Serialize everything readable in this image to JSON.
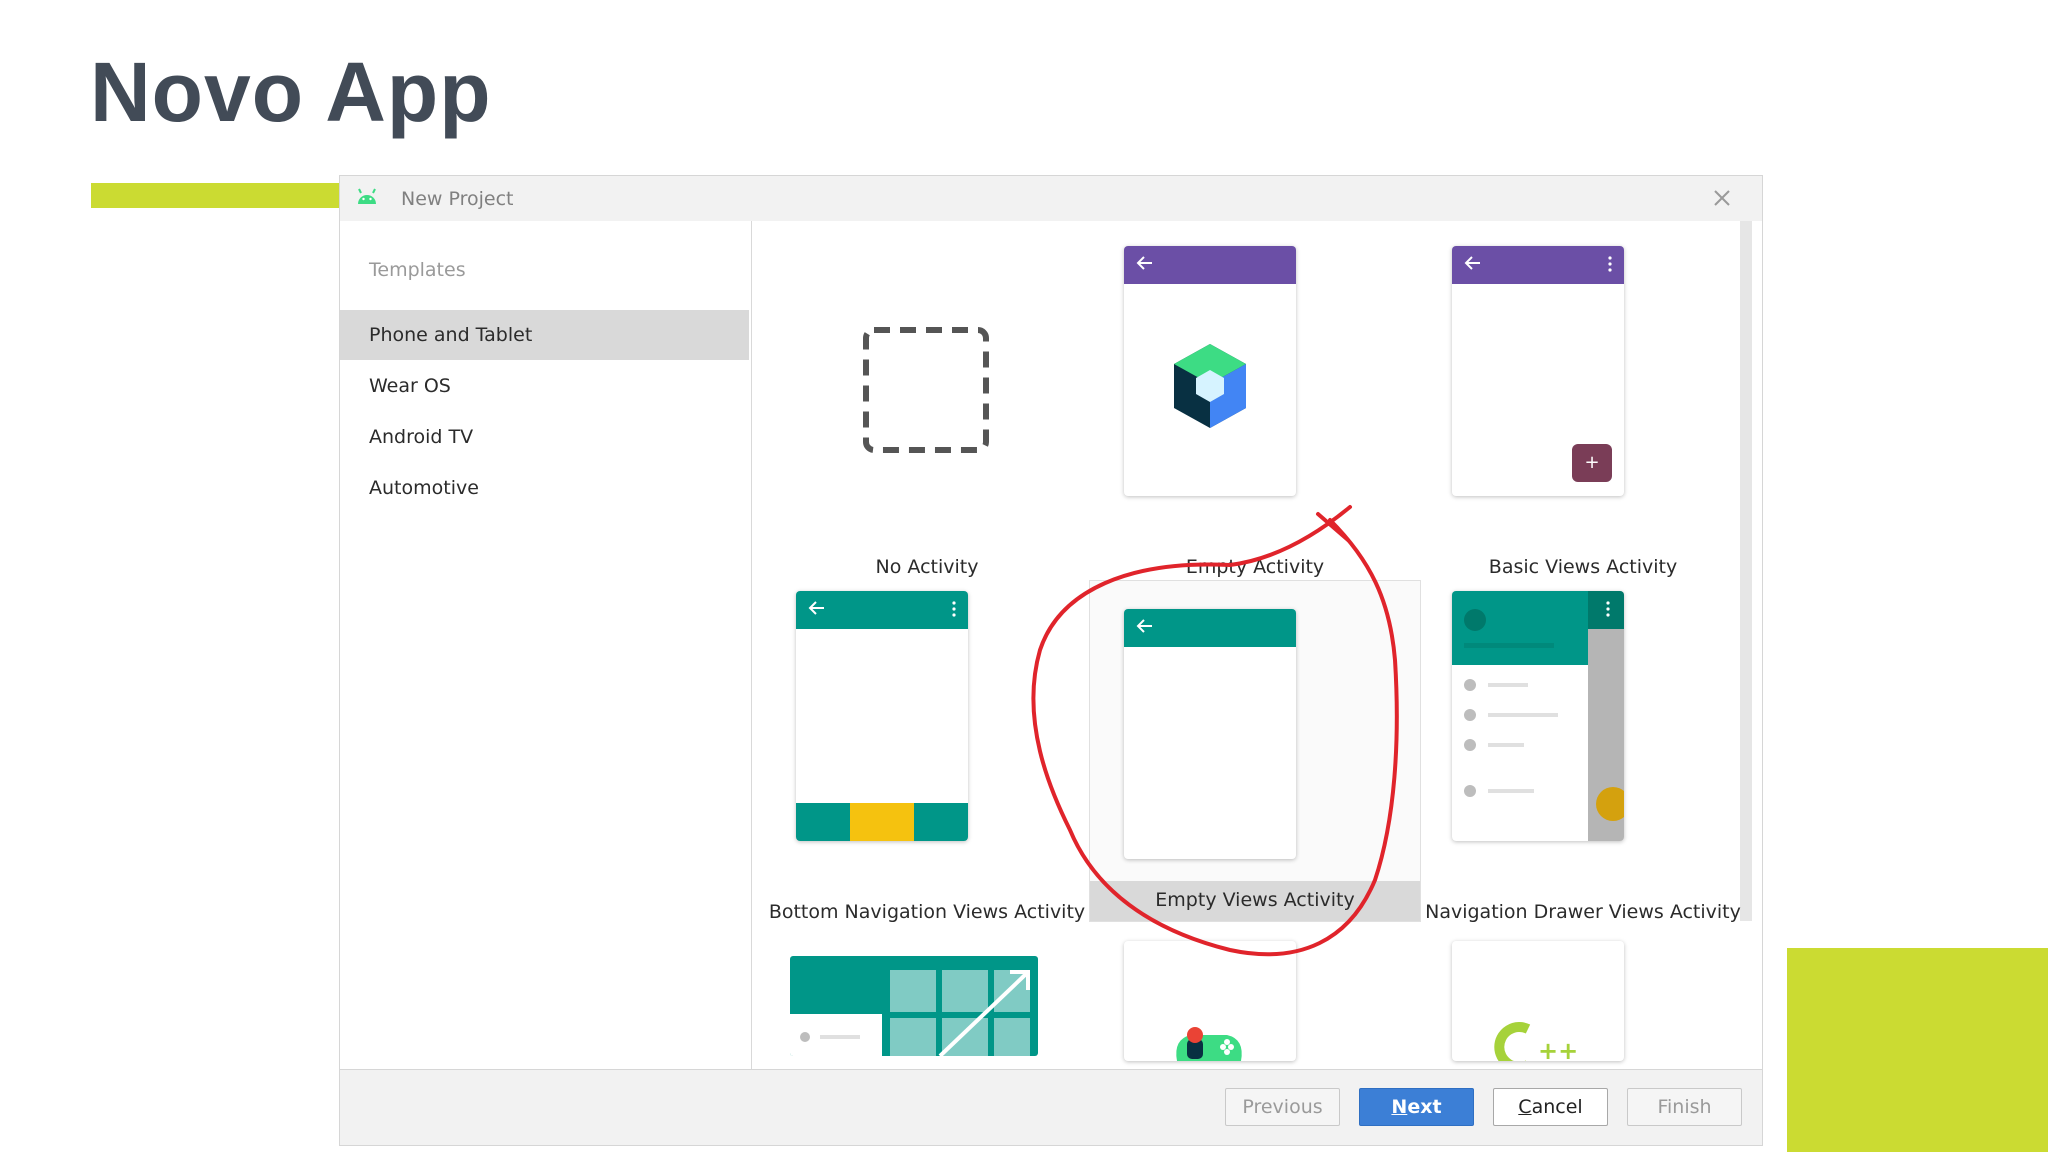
{
  "slide": {
    "title": "Novo App"
  },
  "colors": {
    "accent": "#cbdb32",
    "title": "#424b57",
    "purple": "#6b4fa6",
    "teal": "#009688",
    "primary_button": "#3c7fd6",
    "annotation": "#e0242b"
  },
  "dialog": {
    "title": "New Project",
    "sidebar": {
      "header": "Templates",
      "items": [
        {
          "label": "Phone and Tablet",
          "selected": true
        },
        {
          "label": "Wear OS",
          "selected": false
        },
        {
          "label": "Android TV",
          "selected": false
        },
        {
          "label": "Automotive",
          "selected": false
        }
      ]
    },
    "templates": [
      {
        "label": "No Activity",
        "icon": "dashed-box-icon"
      },
      {
        "label": "Empty Activity",
        "icon": "compose-logo-icon"
      },
      {
        "label": "Basic Views Activity",
        "icon": "fab-icon"
      },
      {
        "label": "Bottom Navigation Views Activity",
        "icon": "bottom-nav-icon"
      },
      {
        "label": "Empty Views Activity",
        "icon": "blank-phone-icon",
        "selected": true
      },
      {
        "label": "Navigation Drawer Views Activity",
        "icon": "nav-drawer-icon"
      }
    ],
    "buttons": {
      "previous": "Previous",
      "next": "Next",
      "cancel": "Cancel",
      "finish": "Finish"
    }
  }
}
